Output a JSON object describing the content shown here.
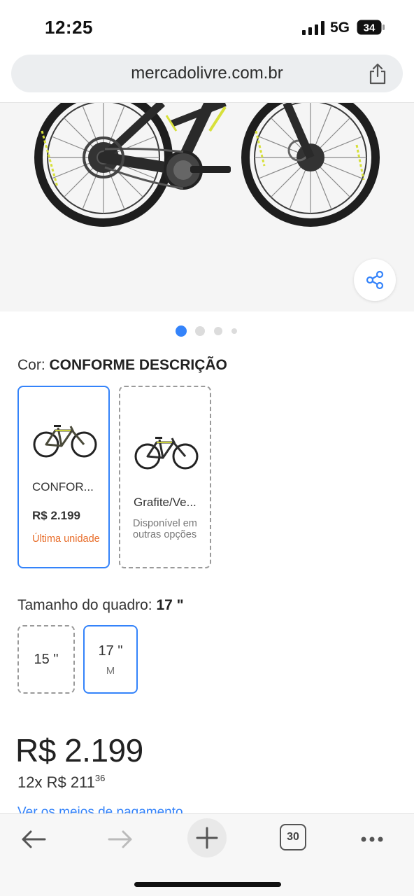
{
  "status_bar": {
    "time": "12:25",
    "network": "5G",
    "battery": "34"
  },
  "browser": {
    "url": "mercadolivre.com.br",
    "share_icon": "share-icon",
    "toolbar": {
      "back_icon": "arrow-left-icon",
      "forward_icon": "arrow-right-icon",
      "new_tab_icon": "plus-icon",
      "tabs_count": "30",
      "more_icon": "ellipsis-icon"
    }
  },
  "gallery": {
    "share_icon": "share-nodes-icon",
    "current_page": 1,
    "page_count": 4
  },
  "color": {
    "label": "Cor: ",
    "selected_value": "CONFORME DESCRIÇÃO",
    "options": [
      {
        "name": "CONFOR...",
        "price": "R$ 2.199",
        "stock": "Última unidade",
        "selected": true
      },
      {
        "name": "Grafite/Ve...",
        "availability": "Disponível em outras opções",
        "selected": false
      }
    ]
  },
  "size": {
    "label": "Tamanho do quadro: ",
    "selected_value": "17 \"",
    "options": [
      {
        "value": "15 \"",
        "sub": "",
        "selected": false
      },
      {
        "value": "17 \"",
        "sub": "M",
        "selected": true
      }
    ]
  },
  "price": {
    "main": "R$ 2.199",
    "installments_prefix": "12x R$ 211",
    "installments_cents": "36",
    "payment_link": "Ver os meios de pagamento"
  },
  "colors": {
    "accent": "#3483fa",
    "stock_warning": "#e86d2a",
    "bike_accent": "#d7e03a"
  }
}
